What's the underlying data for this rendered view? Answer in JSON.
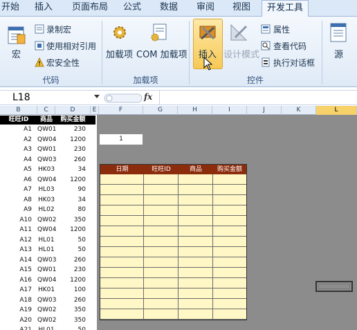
{
  "ribbon": {
    "tabs": [
      "开始",
      "插入",
      "页面布局",
      "公式",
      "数据",
      "审阅",
      "视图",
      "开发工具"
    ],
    "active_tab": "开发工具",
    "groups": {
      "code": {
        "label": "代码",
        "visual_basic_label": "宏",
        "record_macro": "录制宏",
        "relative_ref": "使用相对引用",
        "macro_security": "宏安全性"
      },
      "addins": {
        "label": "加载项",
        "addins": "加载项",
        "com_addins": "COM 加载项"
      },
      "controls": {
        "label": "控件",
        "insert": "插入",
        "design_mode": "设计模式",
        "properties": "属性",
        "view_code": "查看代码",
        "run_dialog": "执行对话框"
      },
      "xml": {
        "source": "源"
      }
    }
  },
  "formula_bar": {
    "name_box": "L18",
    "fx_label": "fx",
    "formula": ""
  },
  "columns": [
    "B",
    "C",
    "D",
    "E",
    "F",
    "G",
    "H",
    "I",
    "J",
    "K",
    "L"
  ],
  "selected_column": "L",
  "source_table": {
    "headers": [
      "旺旺ID",
      "商品",
      "购买金额"
    ],
    "rows": [
      [
        "A1",
        "QW01",
        "230"
      ],
      [
        "A2",
        "QW04",
        "1200"
      ],
      [
        "A3",
        "QW01",
        "230"
      ],
      [
        "A4",
        "QW03",
        "260"
      ],
      [
        "A5",
        "HK03",
        "34"
      ],
      [
        "A6",
        "QW04",
        "1200"
      ],
      [
        "A7",
        "HL03",
        "90"
      ],
      [
        "A8",
        "HK03",
        "34"
      ],
      [
        "A9",
        "HL02",
        "80"
      ],
      [
        "A10",
        "QW02",
        "350"
      ],
      [
        "A11",
        "QW04",
        "1200"
      ],
      [
        "A12",
        "HL01",
        "50"
      ],
      [
        "A13",
        "HL01",
        "50"
      ],
      [
        "A14",
        "QW03",
        "260"
      ],
      [
        "A15",
        "QW01",
        "230"
      ],
      [
        "A16",
        "QW04",
        "1200"
      ],
      [
        "A17",
        "HK01",
        "100"
      ],
      [
        "A18",
        "QW03",
        "260"
      ],
      [
        "A19",
        "QW02",
        "350"
      ],
      [
        "A20",
        "QW02",
        "350"
      ],
      [
        "A21",
        "HL01",
        "50"
      ]
    ]
  },
  "input_cell_value": "1",
  "result_table": {
    "headers": [
      "日期",
      "旺旺ID",
      "商品",
      "购买金额"
    ],
    "row_count": 14
  },
  "colors": {
    "result_header": "#8b2c0c",
    "result_body": "#fff8c6",
    "gray_area": "#8c8c8c",
    "selected_column_header": "#f7d26b"
  }
}
